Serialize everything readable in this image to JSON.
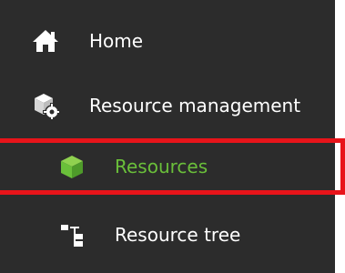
{
  "nav": {
    "items": [
      {
        "label": "Home",
        "icon": "home-icon"
      },
      {
        "label": "Resource management",
        "icon": "resource-management-gear-icon"
      },
      {
        "label": "Resources",
        "icon": "cube-icon",
        "selected": true
      },
      {
        "label": "Resource tree",
        "icon": "tree-structure-icon"
      }
    ]
  },
  "colors": {
    "panel_background": "#2c2c2c",
    "text": "#ffffff",
    "selected_text": "#6abf3a",
    "highlight_border": "#e8141a"
  }
}
